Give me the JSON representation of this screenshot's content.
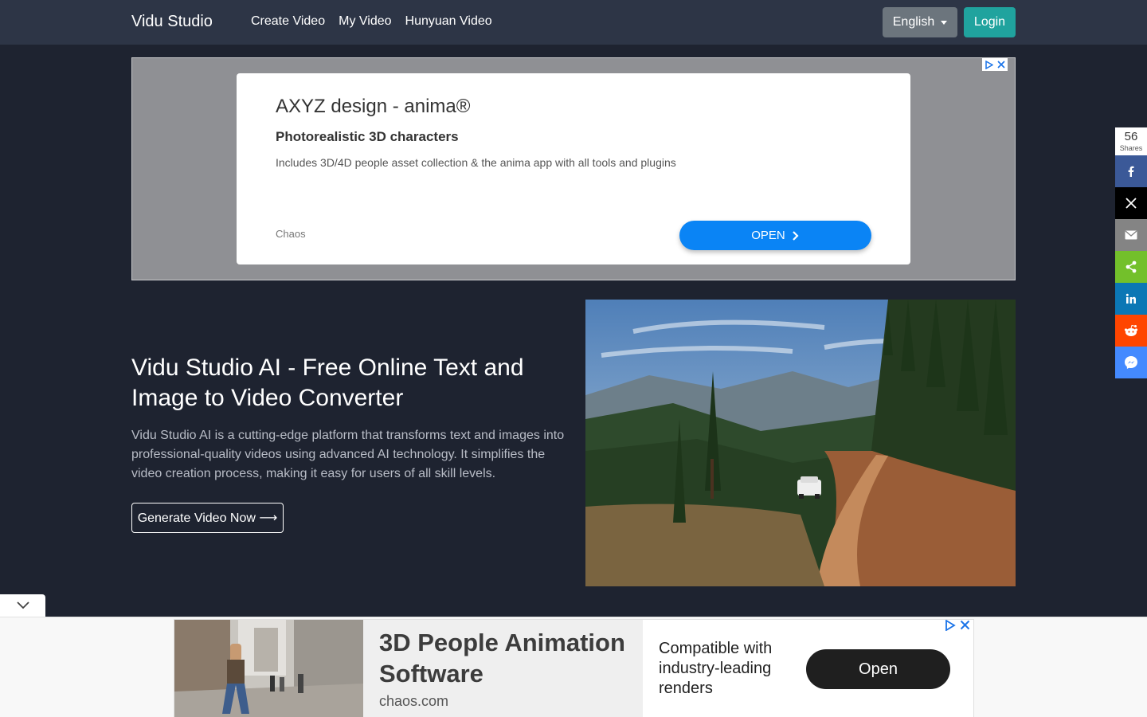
{
  "navbar": {
    "brand": "Vidu Studio",
    "links": [
      "Create Video",
      "My Video",
      "Hunyuan Video"
    ],
    "language_label": "English",
    "login_label": "Login"
  },
  "top_ad": {
    "title": "AXYZ design - anima®",
    "subtitle": "Photorealistic 3D characters",
    "description": "Includes 3D/4D people asset collection & the anima app with all tools and plugins",
    "advertiser": "Chaos",
    "cta": "OPEN"
  },
  "hero": {
    "title": "Vidu Studio AI - Free Online Text and Image to Video Converter",
    "description": "Vidu Studio AI is a cutting-edge platform that transforms text and images into professional-quality videos using advanced AI technology. It simplifies the video creation process, making it easy for users of all skill levels.",
    "cta": "Generate Video Now ⟶"
  },
  "share_bar": {
    "count": "56",
    "count_label": "Shares",
    "buttons": [
      {
        "name": "facebook",
        "icon": "facebook-icon",
        "color": "#3b5998"
      },
      {
        "name": "x",
        "icon": "x-icon",
        "color": "#000000"
      },
      {
        "name": "email",
        "icon": "email-icon",
        "color": "#848484"
      },
      {
        "name": "share",
        "icon": "share-icon",
        "color": "#73c02b"
      },
      {
        "name": "linkedin",
        "icon": "linkedin-icon",
        "color": "#0b77b5"
      },
      {
        "name": "reddit",
        "icon": "reddit-icon",
        "color": "#ff4500"
      },
      {
        "name": "messenger",
        "icon": "messenger-icon",
        "color": "#448aff"
      }
    ]
  },
  "bottom_ad": {
    "title": "3D People Animation Software",
    "domain": "chaos.com",
    "description": "Compatible with industry-leading renders",
    "cta": "Open"
  }
}
